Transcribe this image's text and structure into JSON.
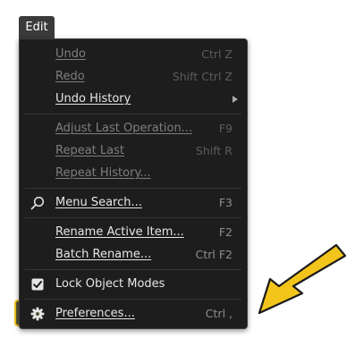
{
  "tab": {
    "label": "Edit"
  },
  "menu": {
    "undo": {
      "label": "Undo",
      "shortcut": "Ctrl Z"
    },
    "redo": {
      "label": "Redo",
      "shortcut": "Shift Ctrl Z"
    },
    "undo_history": {
      "label": "Undo History"
    },
    "adjust_last": {
      "label": "Adjust Last Operation...",
      "shortcut": "F9"
    },
    "repeat_last": {
      "label": "Repeat Last",
      "shortcut": "Shift R"
    },
    "repeat_history": {
      "label": "Repeat History..."
    },
    "menu_search": {
      "label": "Menu Search...",
      "shortcut": "F3",
      "icon": "search-icon"
    },
    "rename_active": {
      "label": "Rename Active Item...",
      "shortcut": "F2"
    },
    "batch_rename": {
      "label": "Batch Rename...",
      "shortcut": "Ctrl F2"
    },
    "lock_modes": {
      "label": "Lock Object Modes",
      "icon": "checkbox-checked-icon"
    },
    "preferences": {
      "label": "Preferences...",
      "shortcut": "Ctrl ,",
      "icon": "gear-icon"
    }
  },
  "colors": {
    "menu_bg": "#1d1d1d",
    "highlight_border": "#f3c41a",
    "highlight_fill": "#5a5637",
    "pointer_arrow": "#f3c41a"
  }
}
